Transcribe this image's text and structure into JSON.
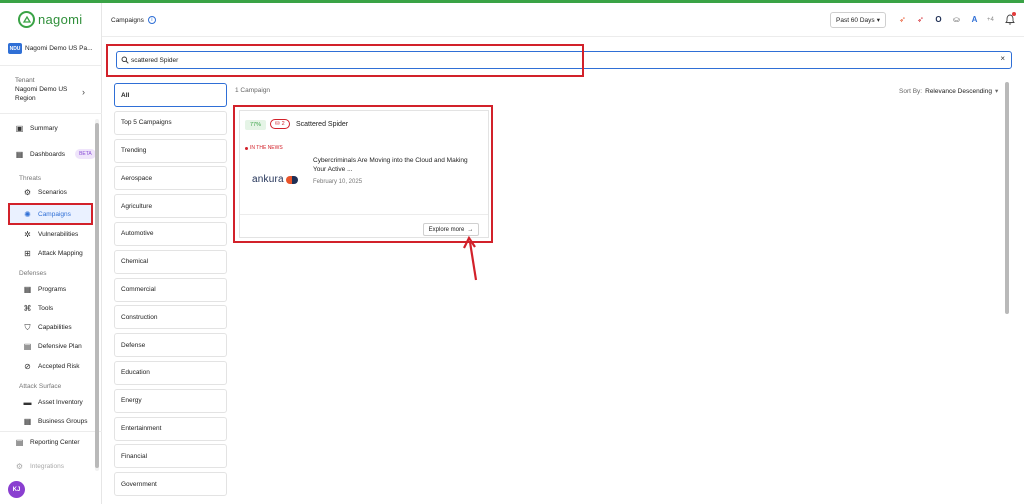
{
  "app": {
    "brand": "nagomi"
  },
  "colors": {
    "accent": "#2f6fd6",
    "brand": "#3aa346",
    "highlight": "#d2212a"
  },
  "org": {
    "badge": "NDU",
    "name": "Nagomi Demo US Pa..."
  },
  "tenant": {
    "label": "Tenant",
    "value": "Nagomi Demo US Region"
  },
  "nav": {
    "summary": "Summary",
    "dashboards": "Dashboards",
    "beta": "BETA",
    "threats_section": "Threats",
    "scenarios": "Scenarios",
    "campaigns": "Campaigns",
    "vulnerabilities": "Vulnerabilities",
    "attack_mapping": "Attack Mapping",
    "defenses_section": "Defenses",
    "programs": "Programs",
    "tools": "Tools",
    "capabilities": "Capabilities",
    "defensive_plan": "Defensive Plan",
    "accepted_risk": "Accepted Risk",
    "attack_surface_section": "Attack Surface",
    "asset_inventory": "Asset Inventory",
    "business_groups": "Business Groups",
    "reporting_center": "Reporting Center",
    "integrations": "Integrations"
  },
  "user": {
    "initials": "KJ"
  },
  "header": {
    "title": "Campaigns",
    "range": "Past 60 Days",
    "more_integrations": "+4"
  },
  "search": {
    "value": "scattered Spider"
  },
  "categories": [
    "All",
    "Top 5 Campaigns",
    "Trending",
    "Aerospace",
    "Agriculture",
    "Automotive",
    "Chemical",
    "Commercial",
    "Construction",
    "Defense",
    "Education",
    "Energy",
    "Entertainment",
    "Financial",
    "Government"
  ],
  "results": {
    "count": "1 Campaign",
    "sort_label": "Sort By:",
    "sort_value": "Relevance Descending"
  },
  "campaign": {
    "percent": "77%",
    "threat_count": "2",
    "title": "Scattered Spider",
    "news_tag": "IN THE NEWS",
    "source": "ankura",
    "headline": "Cybercriminals Are Moving into the Cloud and Making Your Active ...",
    "date": "February 10, 2025",
    "explore": "Explore more",
    "explore_arrow": "→"
  }
}
